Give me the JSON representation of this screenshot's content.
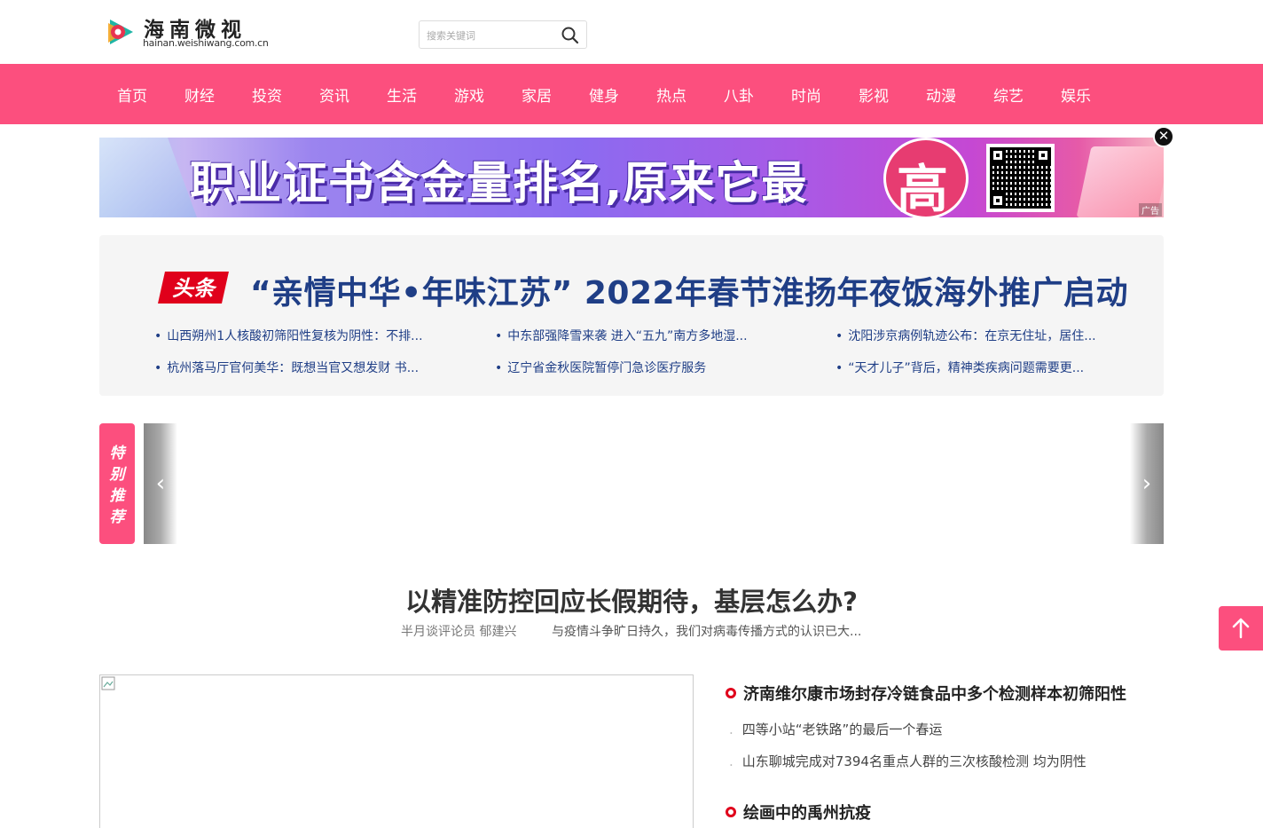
{
  "header": {
    "logo_title": "海南微视",
    "logo_subtitle": "hainan.weishiwang.com.cn",
    "search_placeholder": "搜索关键词",
    "search_icon": "search-icon"
  },
  "nav": {
    "items": [
      "首页",
      "财经",
      "投资",
      "资讯",
      "生活",
      "游戏",
      "家居",
      "健身",
      "热点",
      "八卦",
      "时尚",
      "影视",
      "动漫",
      "综艺",
      "娱乐"
    ]
  },
  "banner": {
    "text": "职业证书含金量排名,原来它最",
    "highlight": "高",
    "ad_tag": "广告",
    "close_icon": "close-icon"
  },
  "headline": {
    "tag": "头条",
    "title": "“亲情中华•年味江苏” 2022年春节淮扬年夜饭海外推广启动",
    "links": [
      "山西朔州1人核酸初筛阳性复核为阴性：不排...",
      "中东部强降雪来袭 进入“五九”南方多地湿...",
      "沈阳涉京病例轨迹公布：在京无住址，居住...",
      "杭州落马厅官何美华：既想当官又想发财 书...",
      "辽宁省金秋医院暂停门急诊医疗服务",
      "“天才儿子”背后，精神类疾病问题需要更..."
    ]
  },
  "special": {
    "label": "特别推荐",
    "prev_icon": "‹",
    "next_icon": "›"
  },
  "feature": {
    "title": "以精准防控回应长假期待，基层怎么办?",
    "author": "半月谈评论员 郁建兴",
    "desc": "与疫情斗争旷日持久，我们对病毒传播方式的认识已大..."
  },
  "news": {
    "groups": [
      {
        "head": "济南维尔康市场封存冷链食品中多个检测样本初筛阳性",
        "subs": [
          "四等小站“老铁路”的最后一个春运",
          "山东聊城完成对7394名重点人群的三次核酸检测 均为阴性"
        ]
      },
      {
        "head": "绘画中的禹州抗疫",
        "subs": []
      }
    ]
  },
  "colors": {
    "brand_pink": "#fc4f7e",
    "headline_blue": "#1f3e86",
    "accent_red": "#e0001b"
  }
}
